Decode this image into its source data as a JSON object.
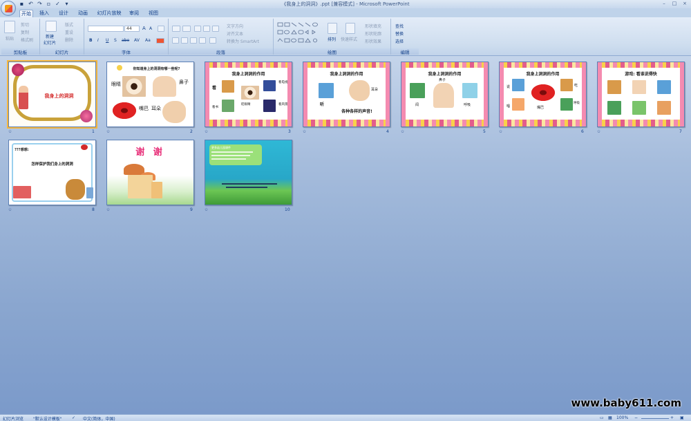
{
  "window": {
    "title": "《我身上的洞洞》.ppt [兼容模式] - Microsoft PowerPoint",
    "controls": [
      "–",
      "□",
      "×"
    ]
  },
  "tabs": [
    "开始",
    "插入",
    "设计",
    "动画",
    "幻灯片放映",
    "审阅",
    "视图"
  ],
  "ribbon": {
    "clipboard": {
      "label": "剪贴板",
      "paste": "粘贴",
      "cut": "剪切",
      "copy": "复制",
      "format_painter": "格式刷"
    },
    "slides": {
      "label": "幻灯片",
      "new_slide": "新建",
      "new_slide2": "幻灯片",
      "layout": "版式",
      "reset": "重设",
      "delete": "删除"
    },
    "font": {
      "label": "字体",
      "font_name": "",
      "font_size": "44",
      "bold": "B",
      "italic": "I",
      "underline": "U",
      "strike": "S",
      "shadow": "abe",
      "spacing": "AV",
      "case": "Aa",
      "grow": "A",
      "shrink": "A"
    },
    "paragraph": {
      "label": "段落",
      "text_direction": "文字方向",
      "align_text": "对齐文本",
      "smartart": "转换为 SmartArt"
    },
    "drawing": {
      "label": "绘图",
      "arrange": "排列",
      "quick_styles": "快速样式",
      "shape_fill": "形状填充",
      "shape_outline": "形状轮廓",
      "shape_effects": "形状效果"
    },
    "editing": {
      "label": "编辑",
      "find": "查找",
      "replace": "替换",
      "select": "选择"
    }
  },
  "slides": [
    {
      "num": "1",
      "title": "我身上的洞洞"
    },
    {
      "num": "2",
      "question": "你知道身上的洞洞有哪一些呢?",
      "labels": [
        "眼睛",
        "鼻子",
        "嘴巴",
        "耳朵"
      ]
    },
    {
      "num": "3",
      "title": "我身上洞洞的作用",
      "labels": [
        "看",
        "看电视",
        "看书",
        "看风景",
        "眨眼睛"
      ]
    },
    {
      "num": "4",
      "title": "我身上洞洞的作用",
      "labels": [
        "听",
        "耳朵"
      ],
      "caption": "各种各样的声音!"
    },
    {
      "num": "5",
      "title": "我身上洞洞的作用",
      "labels": [
        "鼻子",
        "闻",
        "呼吸"
      ]
    },
    {
      "num": "6",
      "title": "我身上洞洞的作用",
      "labels": [
        "说",
        "吃",
        "唱",
        "嘴巴",
        "呼吸"
      ]
    },
    {
      "num": "7",
      "title": "游戏: 看谁说得快"
    },
    {
      "num": "8",
      "question": "???想想:",
      "caption": "怎样保护我们身上的洞洞"
    },
    {
      "num": "9",
      "title": "谢 谢"
    },
    {
      "num": "10",
      "title": "更多幼儿园课件"
    }
  ],
  "status": {
    "view": "幻灯片浏览",
    "theme": "\"默认设计模板\"",
    "language": "中文(简体，中国)",
    "zoom": "100%"
  },
  "watermark": "www.baby611.com",
  "colors": {
    "ribbon_bg": "#dbe6f4",
    "sorter_bg": "#8aa6cf",
    "selection": "#f5b63d",
    "text": "#15428b"
  }
}
